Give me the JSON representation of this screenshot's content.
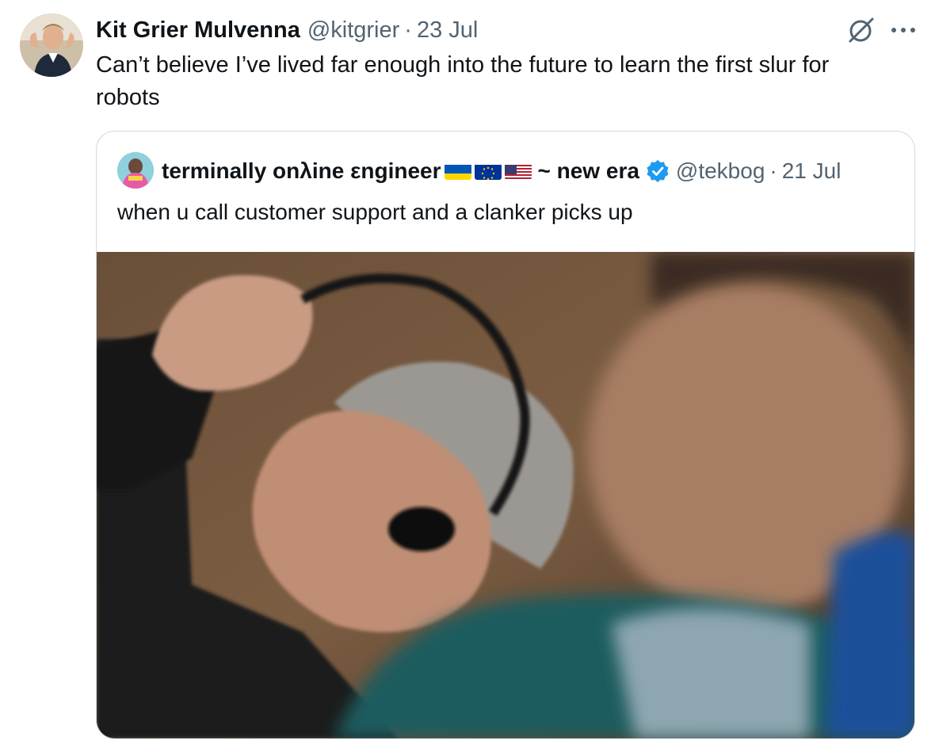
{
  "tweet": {
    "author_name": "Kit Grier Mulvenna",
    "author_handle": "@kitgrier",
    "separator": "·",
    "date": "23 Jul",
    "text": "Can’t believe I’ve lived far enough into the future to learn the first slur for robots",
    "avatar_icon": "profile-photo",
    "grok_icon": "grok-icon",
    "more_icon": "more-horizontal-icon"
  },
  "quoted": {
    "author_name": "terminally onλine εngineer",
    "flags": [
      "ukraine-flag",
      "eu-flag",
      "us-flag"
    ],
    "name_suffix": "~ new era",
    "verified_icon": "verified-badge-icon",
    "author_handle": "@tekbog",
    "separator": "·",
    "date": "21 Jul",
    "text": "when u call customer support and a clanker picks up",
    "media_description_icon": "meme-photo"
  },
  "colors": {
    "text_primary": "#0f1419",
    "text_secondary": "#536471",
    "border": "#cfd9de",
    "verified_blue": "#1d9bf0"
  }
}
